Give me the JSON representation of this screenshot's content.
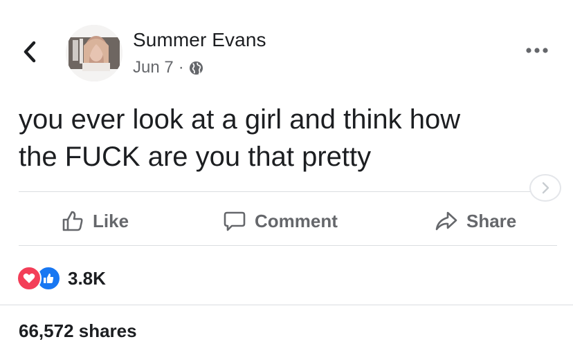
{
  "author": {
    "name": "Summer Evans"
  },
  "post": {
    "date": "Jun 7",
    "separator": "·",
    "text_line1": "you ever look at a girl and think how",
    "text_line2": "the FUCK are you that pretty"
  },
  "actions": {
    "like": "Like",
    "comment": "Comment",
    "share": "Share"
  },
  "stats": {
    "reactions": "3.8K",
    "shares": "66,572 shares"
  },
  "icons": [
    "back-icon",
    "globe-icon",
    "more-icon",
    "chevron-right-icon",
    "like-icon",
    "comment-icon",
    "share-icon",
    "love-reaction-icon",
    "like-reaction-icon"
  ],
  "colors": {
    "text": "#1c1e21",
    "muted": "#65676b",
    "like_blue": "#1877f2",
    "love_red": "#f33e58"
  }
}
